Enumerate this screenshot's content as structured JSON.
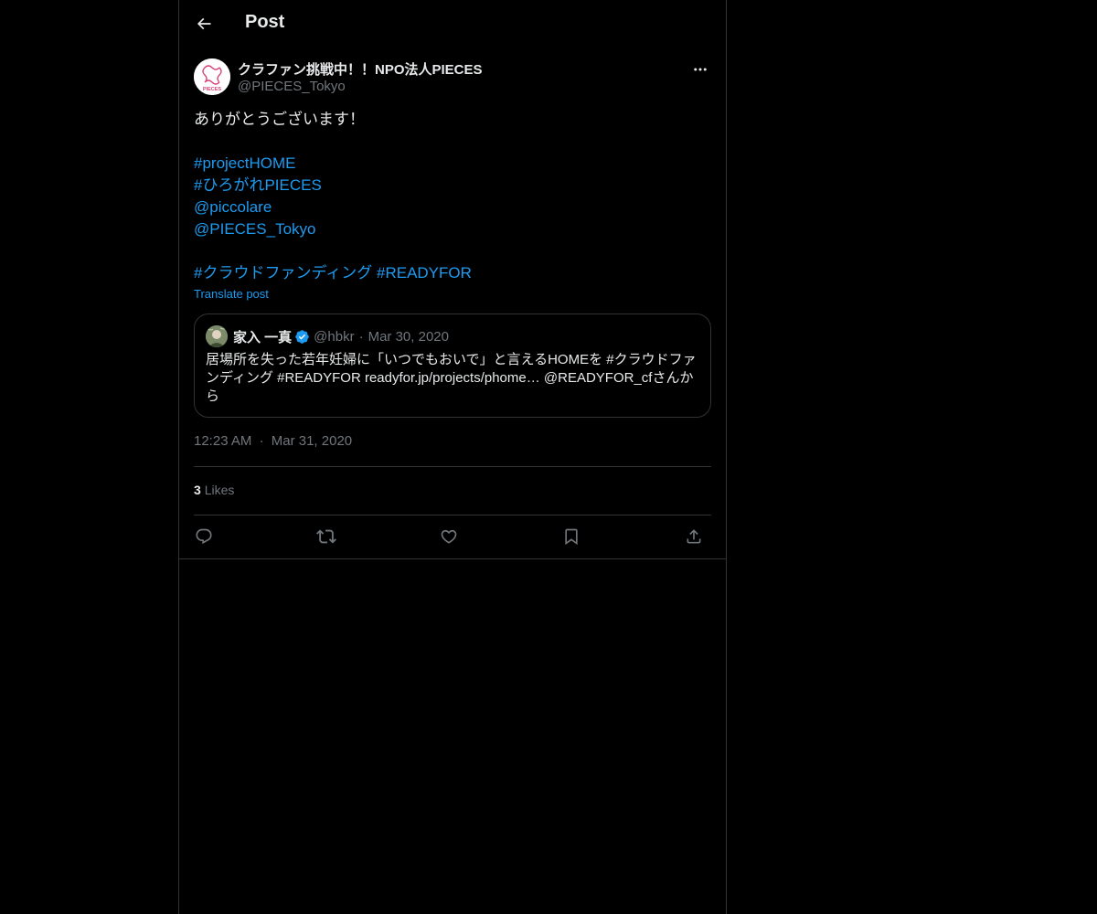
{
  "header": {
    "title": "Post",
    "back_icon": "arrow-left-icon"
  },
  "post": {
    "author_name": "クラファン挑戦中！！NPO法人PIECES",
    "author_handle": "@PIECES_Tokyo",
    "avatar_logo_text": "PIECES",
    "text_line1": "ありがとうございます！",
    "tag_project_home": "#projectHOME",
    "tag_hirogare": "#ひろがれPIECES",
    "mention_piccolare": "@piccolare",
    "mention_pieces": "@PIECES_Tokyo",
    "tag_crowdfunding": "#クラウドファンディング",
    "tag_readyfor": "#READYFOR",
    "translate_label": "Translate post",
    "time": "12:23 AM",
    "date": "Mar 31, 2020",
    "separator": "·",
    "likes_count": "3",
    "likes_label": "Likes"
  },
  "quote": {
    "author_name": "家入 一真",
    "author_handle": "@hbkr",
    "separator": "·",
    "date": "Mar 30, 2020",
    "body": "居場所を失った若年妊婦に「いつでもおいで」と言えるHOMEを #クラウドファンディング #READYFOR  readyfor.jp/projects/phome… @READYFOR_cfさんから"
  },
  "actions": {
    "reply_icon": "reply-icon",
    "retweet_icon": "retweet-icon",
    "like_icon": "heart-icon",
    "bookmark_icon": "bookmark-icon",
    "share_icon": "share-icon"
  },
  "colors": {
    "background": "#000000",
    "text": "#e7e9ea",
    "secondary": "#71767b",
    "link": "#1d9bf0",
    "border": "#2f3336",
    "avatar_accent": "#d9437a"
  }
}
